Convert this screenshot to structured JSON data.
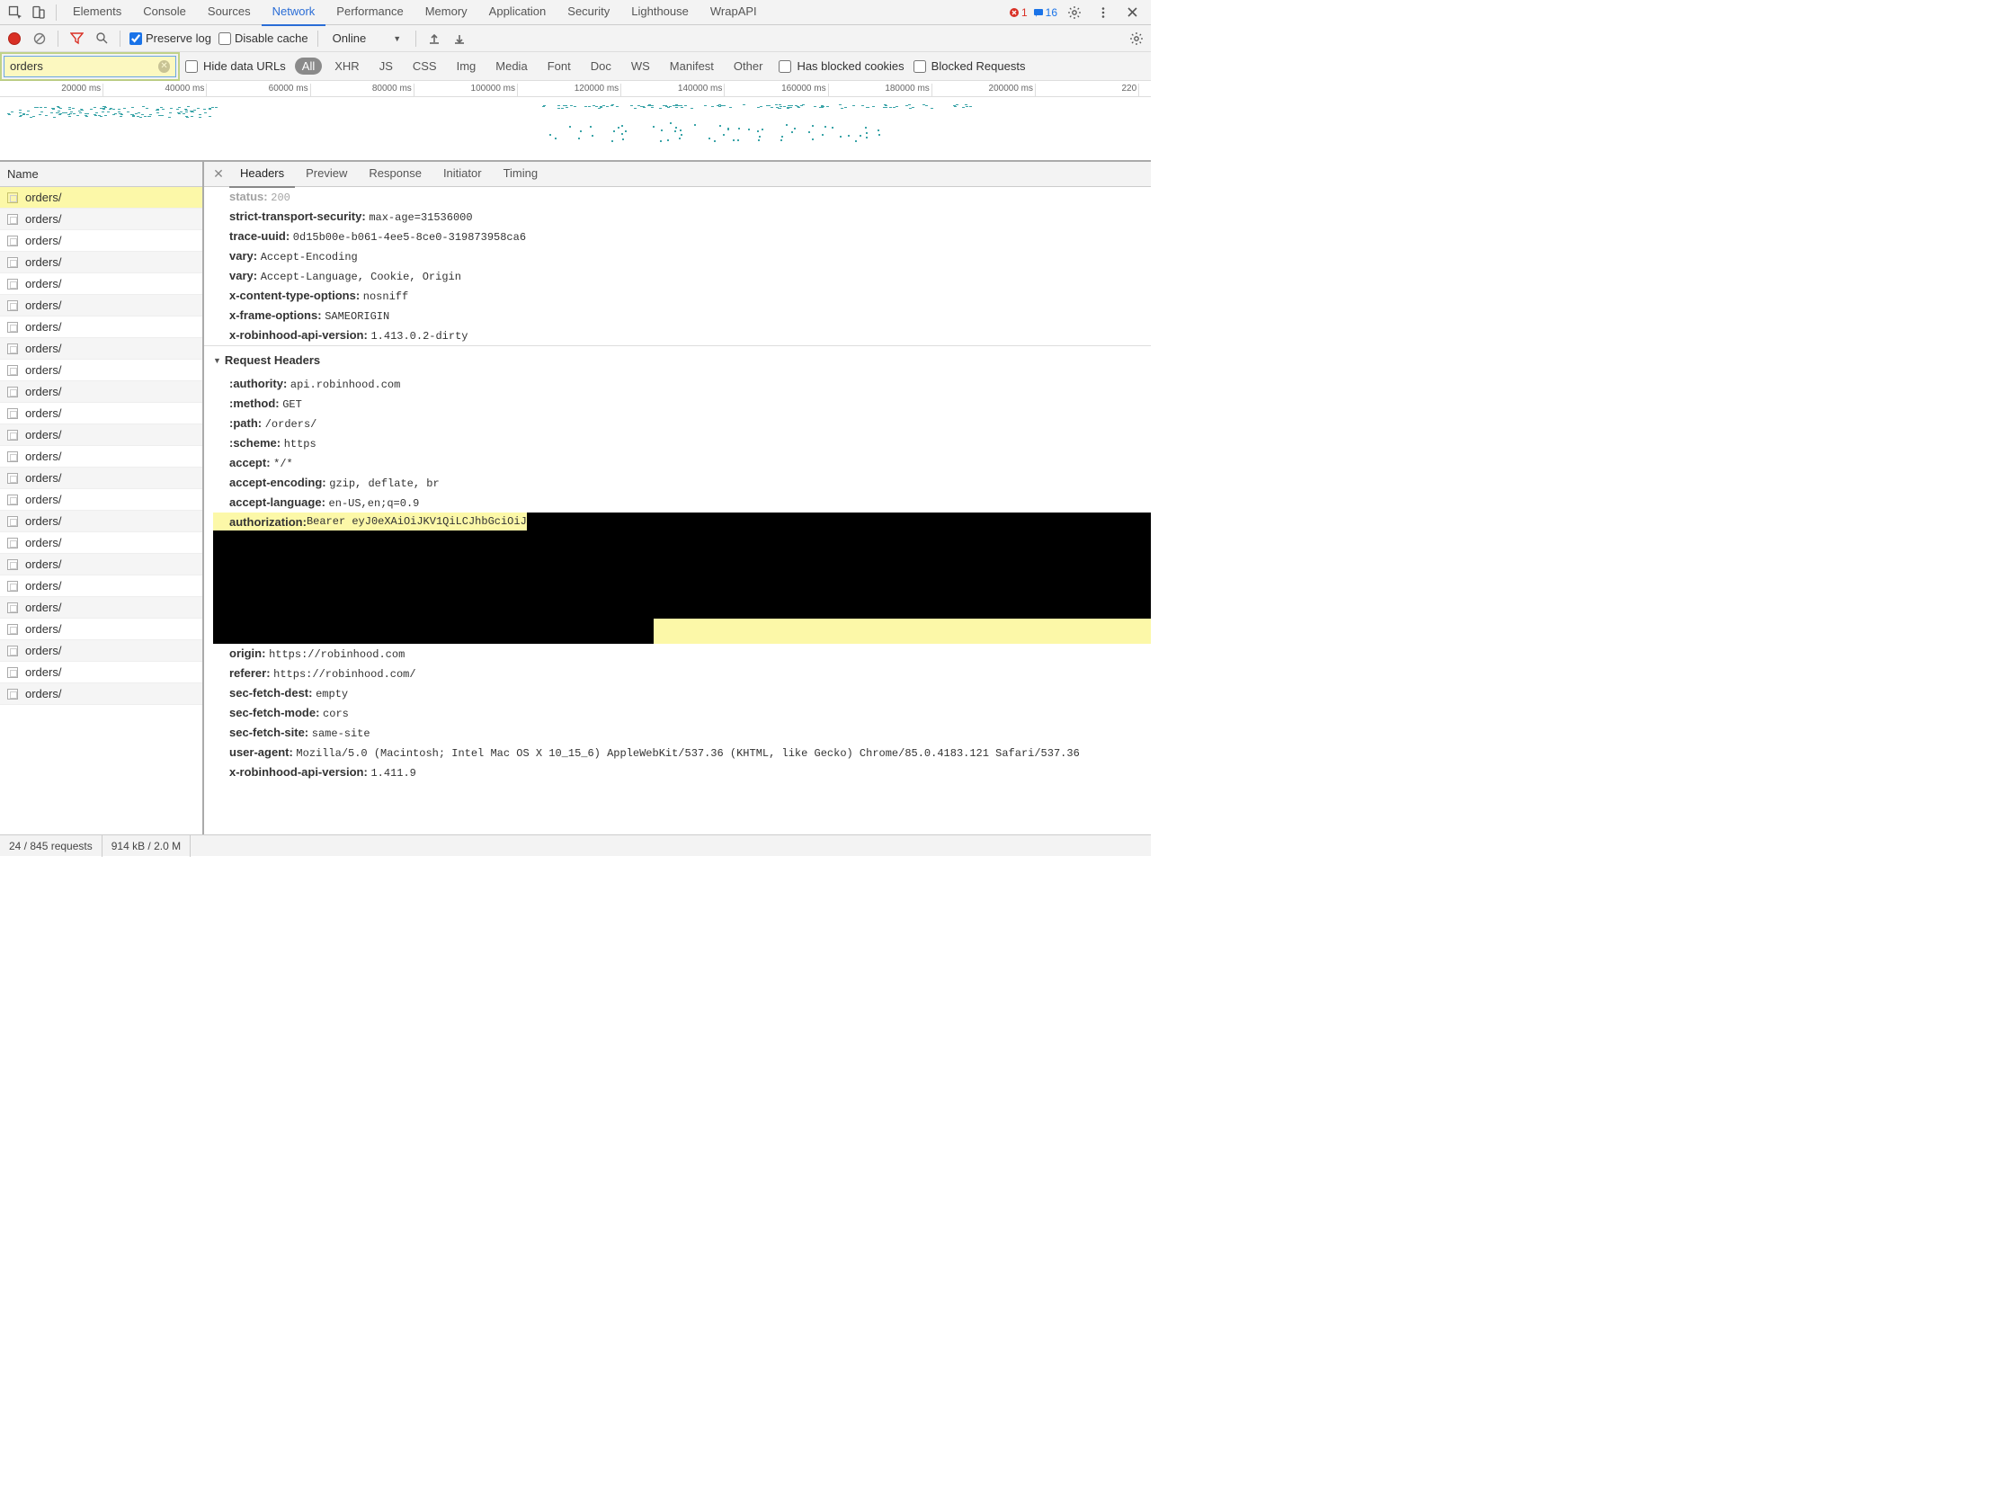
{
  "top": {
    "tabs": [
      "Elements",
      "Console",
      "Sources",
      "Network",
      "Performance",
      "Memory",
      "Application",
      "Security",
      "Lighthouse",
      "WrapAPI"
    ],
    "active_tab": "Network",
    "error_count": "1",
    "message_count": "16"
  },
  "toolbar": {
    "preserve_log_label": "Preserve log",
    "preserve_log_checked": true,
    "disable_cache_label": "Disable cache",
    "disable_cache_checked": false,
    "throttle_value": "Online"
  },
  "filter": {
    "value": "orders",
    "hide_data_urls_label": "Hide data URLs",
    "types": [
      "All",
      "XHR",
      "JS",
      "CSS",
      "Img",
      "Media",
      "Font",
      "Doc",
      "WS",
      "Manifest",
      "Other"
    ],
    "has_blocked_cookies_label": "Has blocked cookies",
    "blocked_requests_label": "Blocked Requests"
  },
  "timeline": {
    "ticks": [
      "20000 ms",
      "40000 ms",
      "60000 ms",
      "80000 ms",
      "100000 ms",
      "120000 ms",
      "140000 ms",
      "160000 ms",
      "180000 ms",
      "200000 ms",
      "220"
    ]
  },
  "request_list": {
    "column_header": "Name",
    "rows": [
      "orders/",
      "orders/",
      "orders/",
      "orders/",
      "orders/",
      "orders/",
      "orders/",
      "orders/",
      "orders/",
      "orders/",
      "orders/",
      "orders/",
      "orders/",
      "orders/",
      "orders/",
      "orders/",
      "orders/",
      "orders/",
      "orders/",
      "orders/",
      "orders/",
      "orders/",
      "orders/",
      "orders/"
    ],
    "selected_index": 0
  },
  "detail_tabs": [
    "Headers",
    "Preview",
    "Response",
    "Initiator",
    "Timing"
  ],
  "detail_active": "Headers",
  "response_headers_partial": [
    {
      "k": "status:",
      "v": "200"
    },
    {
      "k": "strict-transport-security:",
      "v": "max-age=31536000"
    },
    {
      "k": "trace-uuid:",
      "v": "0d15b00e-b061-4ee5-8ce0-319873958ca6"
    },
    {
      "k": "vary:",
      "v": "Accept-Encoding"
    },
    {
      "k": "vary:",
      "v": "Accept-Language, Cookie, Origin"
    },
    {
      "k": "x-content-type-options:",
      "v": "nosniff"
    },
    {
      "k": "x-frame-options:",
      "v": "SAMEORIGIN"
    },
    {
      "k": "x-robinhood-api-version:",
      "v": "1.413.0.2-dirty"
    }
  ],
  "request_headers_title": "Request Headers",
  "request_headers_pre_auth": [
    {
      "k": ":authority:",
      "v": "api.robinhood.com"
    },
    {
      "k": ":method:",
      "v": "GET"
    },
    {
      "k": ":path:",
      "v": "/orders/"
    },
    {
      "k": ":scheme:",
      "v": "https"
    },
    {
      "k": "accept:",
      "v": "*/*"
    },
    {
      "k": "accept-encoding:",
      "v": "gzip, deflate, br"
    },
    {
      "k": "accept-language:",
      "v": "en-US,en;q=0.9"
    }
  ],
  "auth_header": {
    "k": "authorization:",
    "v_visible": "Bearer eyJ0eXAiOiJKV1QiLCJhbGciOiJ"
  },
  "request_headers_post_auth": [
    {
      "k": "origin:",
      "v": "https://robinhood.com"
    },
    {
      "k": "referer:",
      "v": "https://robinhood.com/"
    },
    {
      "k": "sec-fetch-dest:",
      "v": "empty"
    },
    {
      "k": "sec-fetch-mode:",
      "v": "cors"
    },
    {
      "k": "sec-fetch-site:",
      "v": "same-site"
    },
    {
      "k": "user-agent:",
      "v": "Mozilla/5.0 (Macintosh; Intel Mac OS X 10_15_6) AppleWebKit/537.36 (KHTML, like Gecko) Chrome/85.0.4183.121 Safari/537.36"
    },
    {
      "k": "x-robinhood-api-version:",
      "v": "1.411.9"
    }
  ],
  "status_bar": {
    "requests": "24 / 845 requests",
    "transfer": "914 kB / 2.0 M"
  }
}
